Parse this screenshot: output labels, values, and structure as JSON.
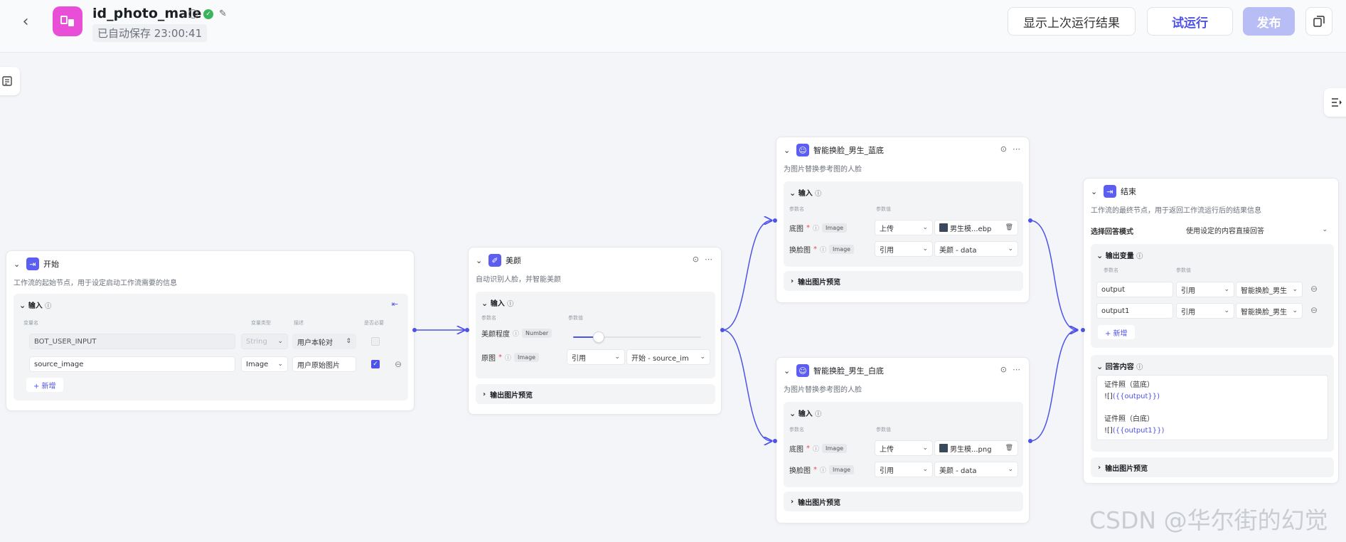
{
  "header": {
    "title": "id_photo_male",
    "saved": "已自动保存 23:00:41",
    "btn_last": "显示上次运行结果",
    "btn_try": "试运行",
    "btn_publish": "发布",
    "brand_color": "#4d53e8"
  },
  "start": {
    "title": "开始",
    "desc": "工作流的起始节点，用于设定启动工作流需要的信息",
    "input_label": "输入",
    "headers": [
      "变量名",
      "变量类型",
      "描述",
      "是否必要"
    ],
    "rows": [
      {
        "name": "BOT_USER_INPUT",
        "type": "String",
        "desc": "用户本轮对",
        "required": false
      },
      {
        "name": "source_image",
        "type": "Image",
        "desc": "用户原始图片",
        "required": true
      }
    ],
    "add": "+ 新增"
  },
  "beauty": {
    "title": "美颜",
    "desc": "自动识别人脸，并智能美颜",
    "input_label": "输入",
    "headers": [
      "参数名",
      "参数值"
    ],
    "level_label": "美颜程度",
    "level_type": "Number",
    "level_value": 0.2,
    "orig_label": "原图",
    "orig_type": "Image",
    "orig_mode": "引用",
    "orig_value": "开始 - source_im",
    "preview": "输出图片预览"
  },
  "swap_blue": {
    "title": "智能换脸_男生_蓝底",
    "desc": "为图片替换参考图的人脸",
    "input_label": "输入",
    "headers": [
      "参数名",
      "参数值"
    ],
    "base_label": "底图",
    "base_type": "Image",
    "base_mode": "上传",
    "base_value": "男生模...ebp",
    "face_label": "换脸图",
    "face_type": "Image",
    "face_mode": "引用",
    "face_value": "美颜 - data",
    "preview": "输出图片预览"
  },
  "swap_white": {
    "title": "智能换脸_男生_白底",
    "desc": "为图片替换参考图的人脸",
    "input_label": "输入",
    "headers": [
      "参数名",
      "参数值"
    ],
    "base_label": "底图",
    "base_type": "Image",
    "base_mode": "上传",
    "base_value": "男生模...png",
    "face_label": "换脸图",
    "face_type": "Image",
    "face_mode": "引用",
    "face_value": "美颜 - data",
    "preview": "输出图片预览"
  },
  "end": {
    "title": "结束",
    "desc": "工作流的最终节点，用于返回工作流运行后的结果信息",
    "mode_label": "选择回答模式",
    "mode_value": "使用设定的内容直接回答",
    "outvar_label": "输出变量",
    "headers": [
      "参数名",
      "参数值"
    ],
    "outputs": [
      {
        "name": "output",
        "mode": "引用",
        "value": "智能换脸_男生"
      },
      {
        "name": "output1",
        "mode": "引用",
        "value": "智能换脸_男生"
      }
    ],
    "add": "+ 新增",
    "answer_label": "回答内容",
    "answer_l1": "证件照（蓝底）",
    "answer_l2_pre": "![]",
    "answer_l2_var": "({{output}})",
    "answer_l3": "证件照（白底）",
    "answer_l4_pre": "![]",
    "answer_l4_var": "({{output1}})",
    "preview": "输出图片预览"
  },
  "watermark": "CSDN @华尔街的幻觉"
}
